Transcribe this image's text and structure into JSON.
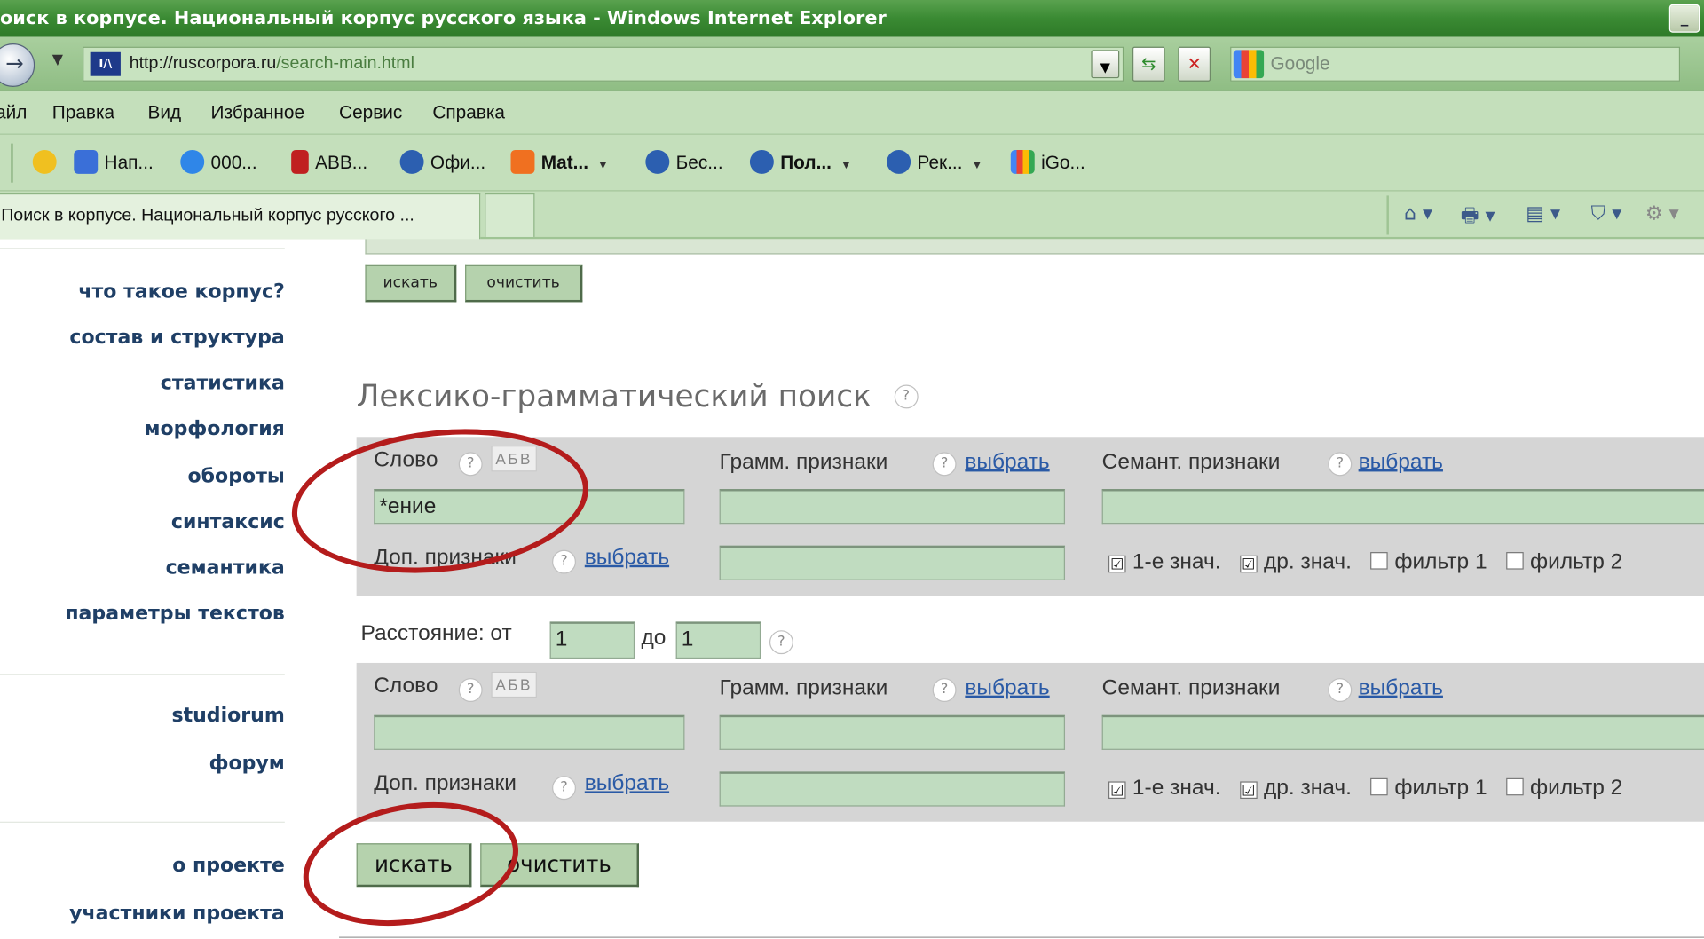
{
  "window": {
    "title": "оиск в корпусе. Национальный корпус русского языка - Windows Internet Explorer"
  },
  "address_bar": {
    "url_host": "http://ruscorpora.ru",
    "url_path": "/search-main.html",
    "search_placeholder": "Google"
  },
  "menu": [
    "айл",
    "Правка",
    "Вид",
    "Избранное",
    "Сервис",
    "Справка"
  ],
  "favorites": [
    {
      "label": "Нап...",
      "color": "#3a6fd8"
    },
    {
      "label": "000...",
      "color": "#2f86e8"
    },
    {
      "label": "ABB...",
      "color": "#c02020"
    },
    {
      "label": "Офи...",
      "color": "#2c5fb0"
    },
    {
      "label": "Mat...",
      "color": "#f07020",
      "bold": true
    },
    {
      "label": "Бес...",
      "color": "#2c5fb0"
    },
    {
      "label": "Пол...",
      "color": "#2c5fb0",
      "bold": true
    },
    {
      "label": "Рек...",
      "color": "#2c5fb0"
    },
    {
      "label": "iGo...",
      "color": "#34a853"
    }
  ],
  "tab": {
    "title": "Поиск в корпусе. Национальный корпус русского ..."
  },
  "sidebar": {
    "group1": [
      "что такое корпус?",
      "состав и структура",
      "статистика",
      "морфология",
      "обороты",
      "синтаксис",
      "семантика",
      "параметры текстов"
    ],
    "group2": [
      "studiorum",
      "форум"
    ],
    "group3": [
      "о проекте",
      "участники проекта"
    ]
  },
  "top_buttons": {
    "search": "искать",
    "clear": "очистить"
  },
  "section": {
    "title": "Лексико-грамматический поиск",
    "help": "?"
  },
  "labels": {
    "word": "Слово",
    "help": "?",
    "abv": "АБВ",
    "gramm": "Грамм. признаки",
    "semant": "Семант. признаки",
    "choose": "выбрать",
    "extra": "Доп. признаки",
    "cb1": "1-е знач.",
    "cb2": "др. знач.",
    "cb3": "фильтр 1",
    "cb4": "фильтр 2",
    "check": "☑"
  },
  "word1": {
    "value": "*ение"
  },
  "word2": {
    "value": ""
  },
  "distance": {
    "label_from": "Расстояние: от",
    "from": "1",
    "label_to": "до",
    "to": "1"
  },
  "bottom_buttons": {
    "search": "искать",
    "clear": "очистить"
  },
  "colors": {
    "annotation": "#b41c1c",
    "button": "#b5d2ad",
    "field": "#c0dcc0",
    "panel": "#d5d5d5"
  }
}
